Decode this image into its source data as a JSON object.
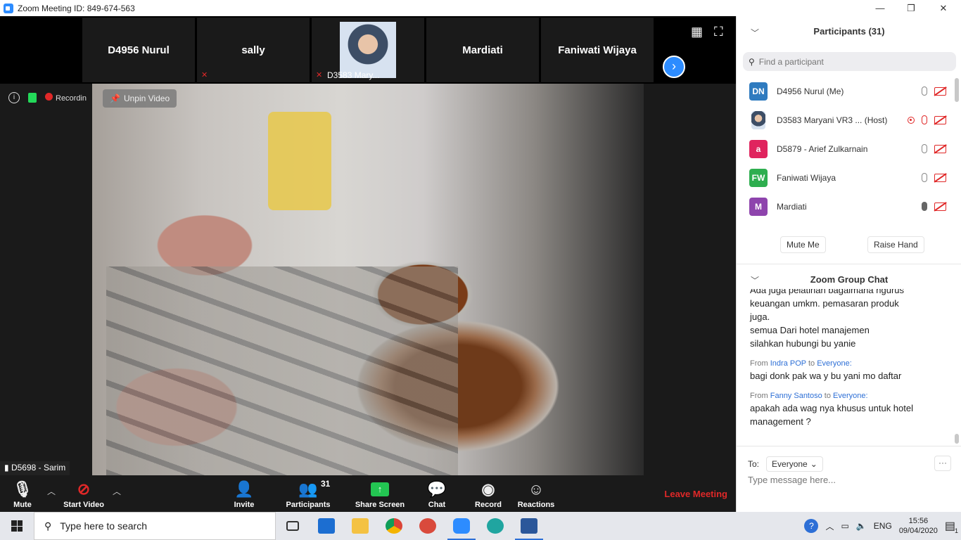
{
  "window": {
    "title": "Zoom Meeting ID: 849-674-563",
    "minimize": "—",
    "restore": "❐",
    "close": "✕"
  },
  "strip": {
    "tiles": [
      {
        "name": "D4956 Nurul"
      },
      {
        "name": "sally"
      },
      {
        "name": "D3583 Mary..."
      },
      {
        "name": "Mardiati"
      },
      {
        "name": "Faniwati Wijaya"
      }
    ],
    "grid_icon": "▦",
    "fullscreen_icon": "⛶",
    "next_icon": "›"
  },
  "status": {
    "info": "i",
    "recording": "Recordin"
  },
  "video": {
    "unpin_label": "Unpin Video",
    "speaker_name": "D5698 - Sarim"
  },
  "toolbar": {
    "mute": "Mute",
    "start_video": "Start Video",
    "invite": "Invite",
    "participants": "Participants",
    "participants_count": "31",
    "share_screen": "Share Screen",
    "chat": "Chat",
    "record": "Record",
    "reactions": "Reactions",
    "leave": "Leave Meeting"
  },
  "participants_panel": {
    "title": "Participants (31)",
    "search_placeholder": "Find a participant",
    "list": [
      {
        "initials": "DN",
        "name": "D4956 Nurul (Me)",
        "color": "#2f7bbf"
      },
      {
        "initials": "",
        "name": "D3583 Maryani VR3 ...  (Host)",
        "color": "#3d4e66"
      },
      {
        "initials": "a",
        "name": "D5879 - Arief Zulkarnain",
        "color": "#e0245e"
      },
      {
        "initials": "FW",
        "name": "Faniwati Wijaya",
        "color": "#2eae4f"
      },
      {
        "initials": "M",
        "name": "Mardiati",
        "color": "#8e44ad"
      }
    ],
    "mute_me": "Mute Me",
    "raise_hand": "Raise Hand"
  },
  "chat_panel": {
    "title": "Zoom Group Chat",
    "partial_top": "Ada juga pelatihan bagaimana ngurus",
    "lines": [
      "keuangan umkm. pemasaran produk",
      "juga.",
      "semua Dari hotel manajemen",
      "silahkan hubungi bu yanie"
    ],
    "messages": [
      {
        "from": "Indra POP",
        "to": "Everyone:",
        "text": "bagi donk pak wa y bu yani mo daftar"
      },
      {
        "from": "Fanny Santoso",
        "to": "Everyone:",
        "text": "apakah ada wag nya khusus untuk hotel management ?"
      }
    ],
    "from_label": "From",
    "to_label": "to",
    "to_prefix": "To:",
    "recipient": "Everyone",
    "more": "···",
    "input_placeholder": "Type message here..."
  },
  "taskbar": {
    "search_placeholder": "Type here to search",
    "lang": "ENG",
    "time": "15:56",
    "date": "09/04/2020",
    "notif_count": "1"
  }
}
